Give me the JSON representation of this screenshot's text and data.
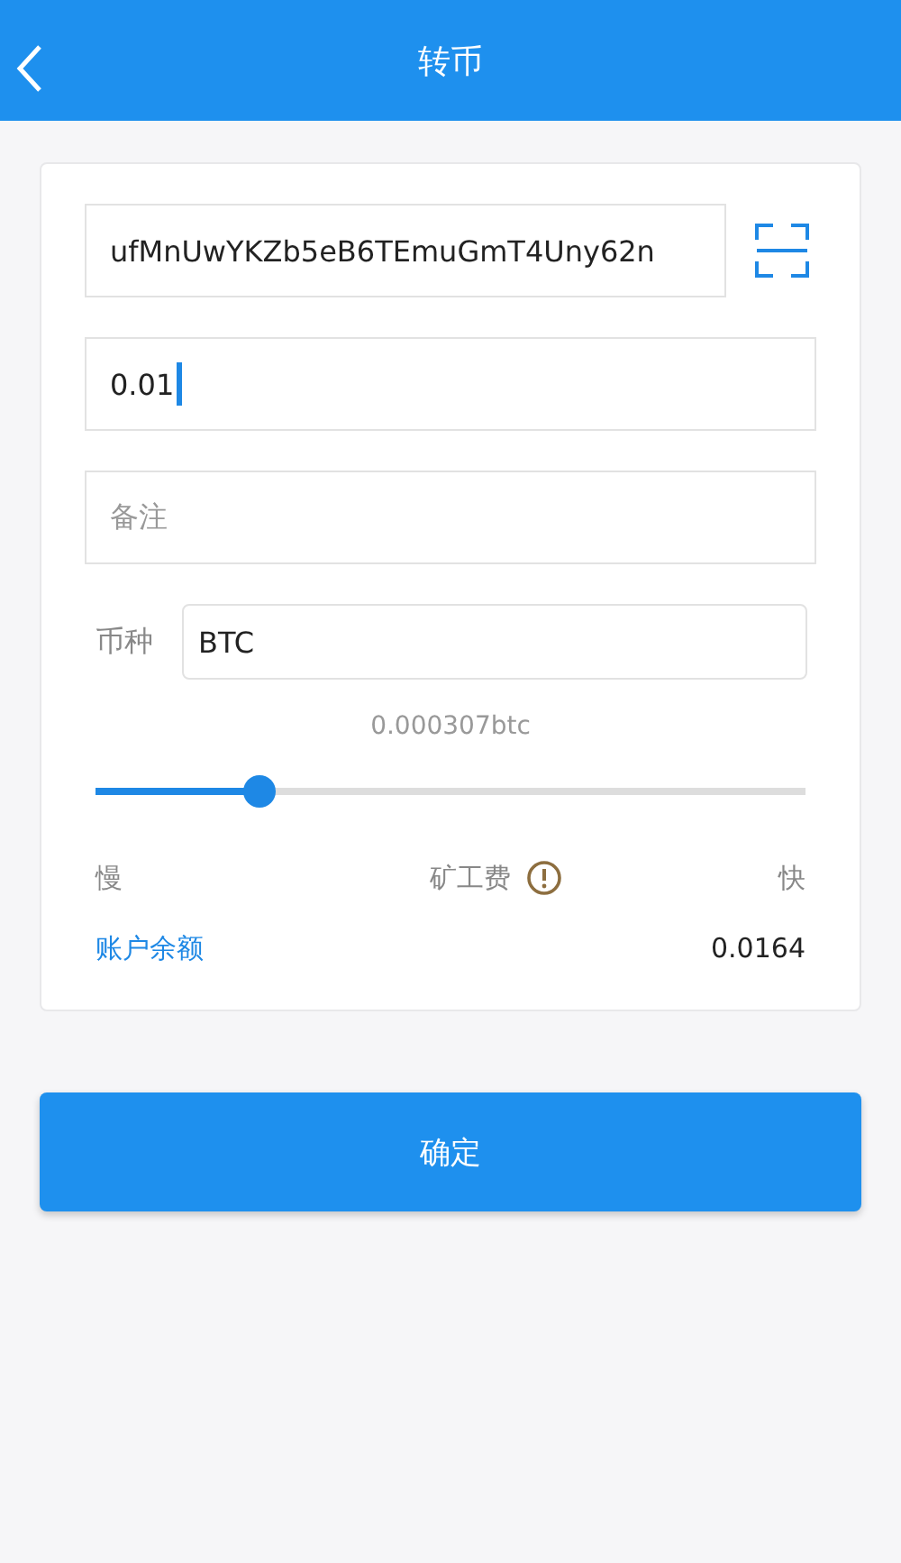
{
  "header": {
    "title": "转币"
  },
  "address": {
    "value": "ufMnUwYKZb5eB6TEmuGmT4Uny62n"
  },
  "amount": {
    "value": "0.01",
    "focused": true
  },
  "remark": {
    "placeholder": "备注"
  },
  "currency": {
    "label": "币种",
    "value": "BTC"
  },
  "fee": {
    "reading": "0.000307btc",
    "level": 0.23,
    "slow": "慢",
    "label": "矿工费",
    "fast": "快"
  },
  "balance": {
    "label": "账户余额",
    "value": "0.0164"
  },
  "confirm_button": "确定"
}
